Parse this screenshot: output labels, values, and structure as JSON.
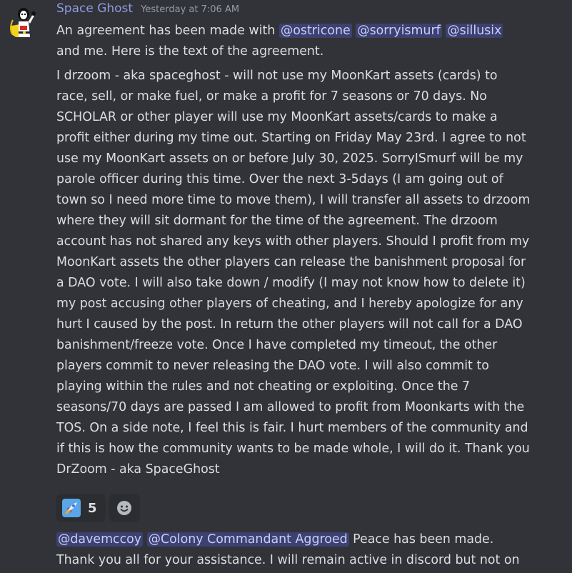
{
  "message": {
    "username": "Space Ghost",
    "timestamp": "Yesterday at 7:06 AM",
    "intro": {
      "prefix": "An agreement has been made with ",
      "mentions": [
        "@ostricone",
        "@sorryismurf",
        "@sillusix"
      ],
      "line2": "and me. Here is the text of the agreement."
    },
    "body_lines": [
      "I drzoom - aka spaceghost - will not use my MoonKart assets (cards) to",
      "race, sell, or make fuel, or make a profit for 7 seasons or 70 days. No",
      "SCHOLAR or other player will use my MoonKart assets/cards to make a",
      "profit either during my time out. Starting on Friday May 23rd. I agree to not",
      "use my MoonKart assets on or before July 30, 2025. SorryISmurf will be my",
      "parole officer during this time. Over the next 3-5days (I am going out of",
      "town so I need more time to move them), I will transfer all assets to drzoom",
      "where they will sit dormant for the time of the agreement. The drzoom",
      "account has not shared any keys with other players. Should I profit from my",
      "MoonKart assets the other players can release the banishment proposal for",
      "a DAO vote. I will also take down / modify (I may not know how to delete it)",
      "my post accusing other players of cheating, and I hereby apologize for any",
      "hurt I caused by the post. In return the other players will not call for a DAO",
      "banishment/freeze vote. Once I have completed my timeout, the other",
      "players commit to never releasing the DAO vote. I will also commit to",
      "playing within the rules and not cheating or exploiting. Once the 7",
      "seasons/70 days are passed I am allowed to profit from Moonkarts with the",
      "TOS. On a side note, I feel this is fair. I hurt members of the community and",
      "if this is how the community wants to be made whole, I will do it. Thank you",
      "DrZoom - aka SpaceGhost"
    ],
    "reactions": [
      {
        "emoji": "rocket-icon",
        "count": "5"
      },
      {
        "emoji": "add-reaction-icon",
        "count": ""
      }
    ]
  },
  "followup": {
    "mentions": [
      "@davemccoy",
      "@Colony Commandant Aggroed"
    ],
    "line1_suffix": " Peace has been made.",
    "line2": "Thank you all for your assistance. I will remain active in discord but not on"
  }
}
